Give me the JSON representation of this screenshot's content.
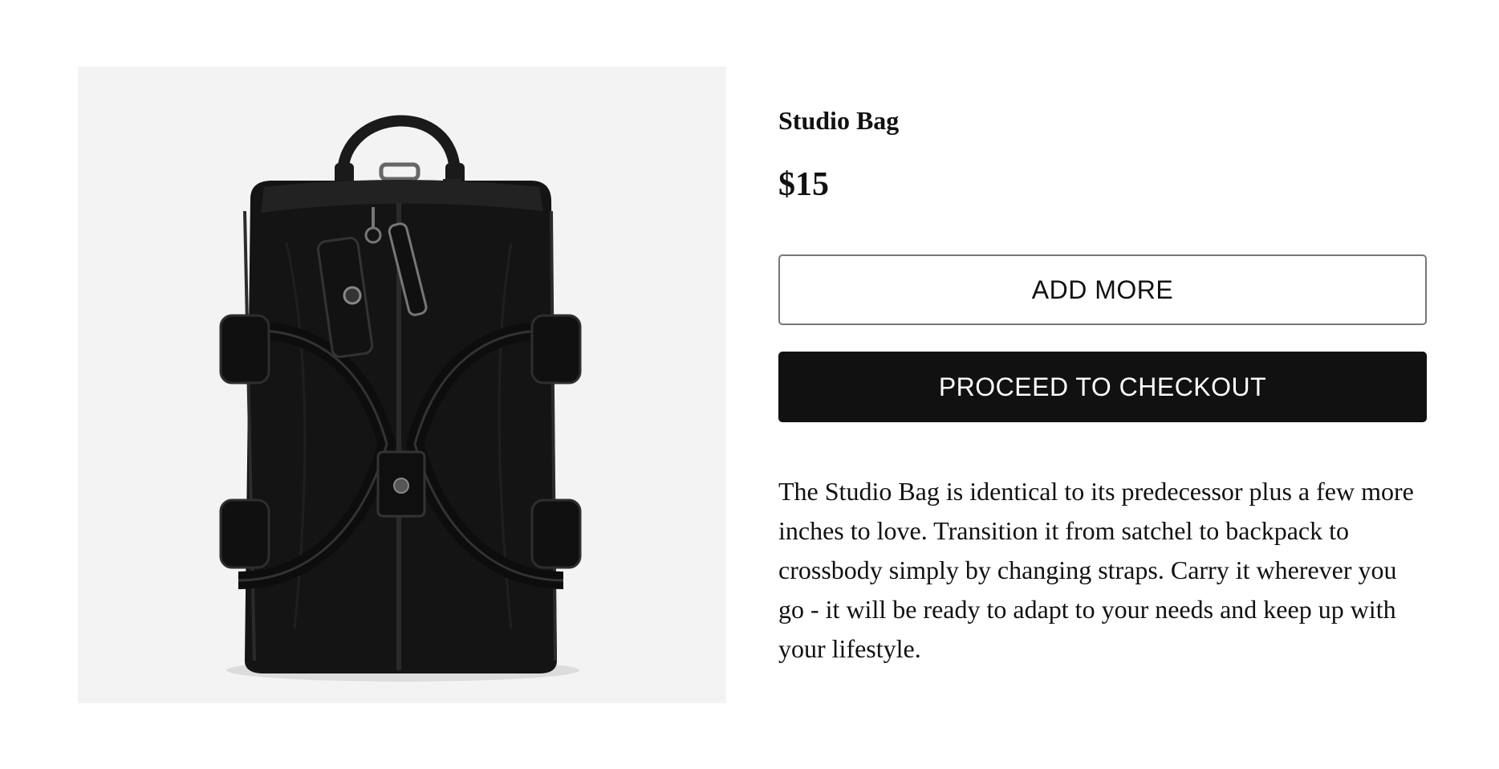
{
  "product": {
    "title": "Studio Bag",
    "price": "$15",
    "image_alt": "black backpack",
    "description": "The Studio Bag is identical to its predecessor plus a few more inches to love. Transition it from satchel to backpack to crossbody simply by changing straps. Carry it wherever you go - it will be ready to adapt to your needs and keep up with your lifestyle."
  },
  "actions": {
    "add_more_label": "ADD MORE",
    "checkout_label": "PROCEED TO CHECKOUT"
  },
  "colors": {
    "image_background": "#f3f3f3",
    "checkout_button": "#111111",
    "text": "#111111"
  }
}
